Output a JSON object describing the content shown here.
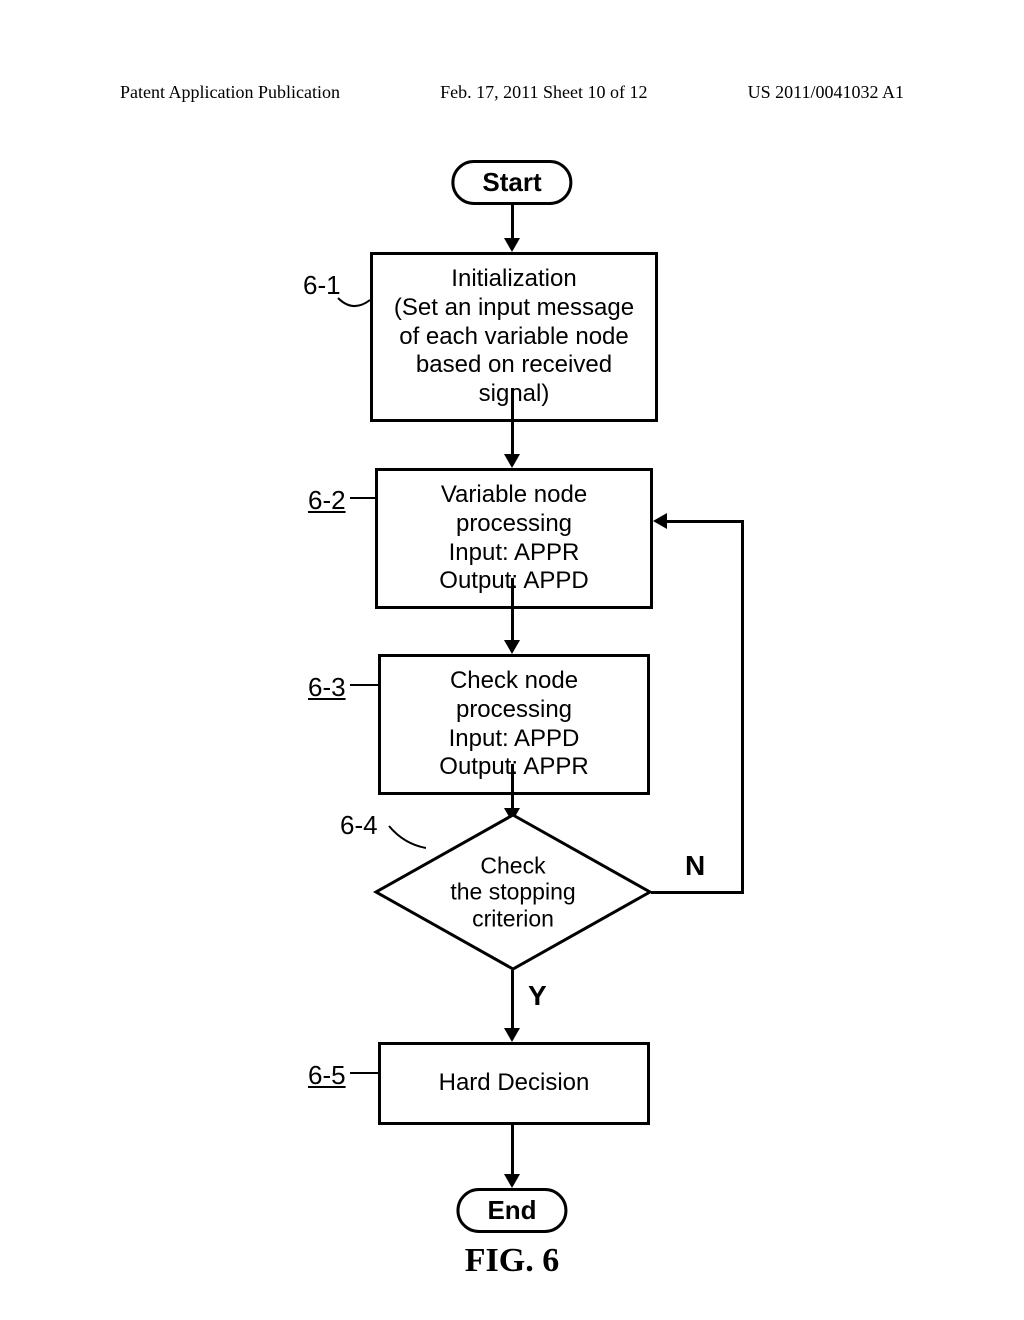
{
  "header": {
    "left": "Patent Application Publication",
    "center": "Feb. 17, 2011  Sheet 10 of 12",
    "right": "US 2011/0041032 A1"
  },
  "flowchart": {
    "start": "Start",
    "end": "End",
    "steps": {
      "s1": {
        "label": "6-1",
        "line1": "Initialization",
        "line2": "(Set an input message",
        "line3": "of each variable node",
        "line4": "based on received signal)"
      },
      "s2": {
        "label": "6-2",
        "line1": "Variable node processing",
        "line2": "Input: APPR",
        "line3": "Output: APPD"
      },
      "s3": {
        "label": "6-3",
        "line1": "Check node processing",
        "line2": "Input: APPD",
        "line3": "Output: APPR"
      },
      "s4": {
        "label": "6-4",
        "line1": "Check",
        "line2": "the stopping",
        "line3": "criterion"
      },
      "s5": {
        "label": "6-5",
        "text": "Hard Decision"
      }
    },
    "yes": "Y",
    "no": "N"
  },
  "figure_label": "FIG. 6"
}
